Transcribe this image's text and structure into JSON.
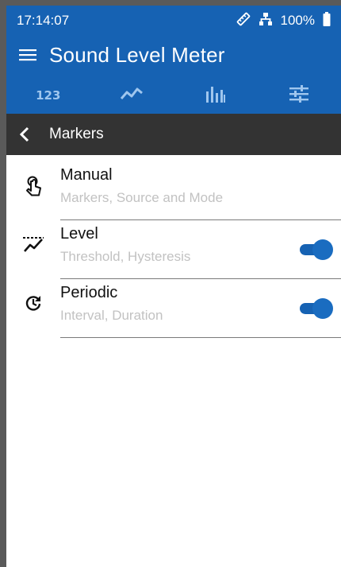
{
  "status": {
    "time": "17:14:07",
    "battery": "100%"
  },
  "app": {
    "title": "Sound Level Meter"
  },
  "tabs": [
    {
      "label": "123",
      "icon": "numeric-tab-icon"
    },
    {
      "icon": "line-chart-icon"
    },
    {
      "icon": "bar-chart-icon"
    },
    {
      "icon": "sliders-icon"
    }
  ],
  "header": {
    "title": "Markers"
  },
  "items": [
    {
      "label": "Manual",
      "subtitle": "Markers, Source and Mode",
      "icon": "touch-gesture-icon",
      "toggle": null
    },
    {
      "label": "Level",
      "subtitle": "Threshold, Hysteresis",
      "icon": "level-threshold-icon",
      "toggle": true
    },
    {
      "label": "Periodic",
      "subtitle": "Interval, Duration",
      "icon": "periodic-timer-icon",
      "toggle": true
    }
  ],
  "colors": {
    "primary": "#1662b3",
    "subheader": "#333333",
    "subtitle": "#c2c2c2"
  }
}
